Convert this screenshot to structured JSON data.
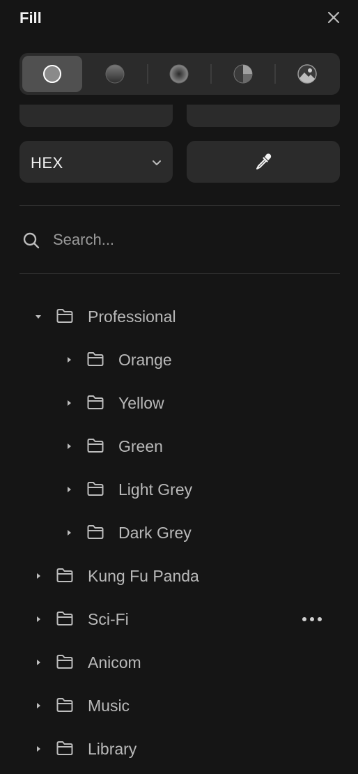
{
  "header": {
    "title": "Fill",
    "close_icon": "close-icon"
  },
  "fill_types": [
    {
      "name": "solid",
      "icon": "solid-fill-icon",
      "active": true
    },
    {
      "name": "linear-gradient",
      "icon": "linear-gradient-icon",
      "active": false
    },
    {
      "name": "radial-gradient",
      "icon": "radial-gradient-icon",
      "active": false
    },
    {
      "name": "angular-gradient",
      "icon": "angular-gradient-icon",
      "active": false
    },
    {
      "name": "image",
      "icon": "image-fill-icon",
      "active": false
    }
  ],
  "color_format": {
    "value": "HEX",
    "icon": "chevron-down-icon"
  },
  "eyedropper": {
    "icon": "eyedropper-icon"
  },
  "search": {
    "placeholder": "Search...",
    "value": "",
    "icon": "search-icon"
  },
  "tree": [
    {
      "label": "Professional",
      "expanded": true,
      "level": 0
    },
    {
      "label": "Orange",
      "expanded": false,
      "level": 1
    },
    {
      "label": "Yellow",
      "expanded": false,
      "level": 1
    },
    {
      "label": "Green",
      "expanded": false,
      "level": 1
    },
    {
      "label": "Light Grey",
      "expanded": false,
      "level": 1
    },
    {
      "label": "Dark Grey",
      "expanded": false,
      "level": 1
    },
    {
      "label": "Kung Fu Panda",
      "expanded": false,
      "level": 0
    },
    {
      "label": "Sci-Fi",
      "expanded": false,
      "level": 0,
      "hovered": true
    },
    {
      "label": "Anicom",
      "expanded": false,
      "level": 0
    },
    {
      "label": "Music",
      "expanded": false,
      "level": 0
    },
    {
      "label": "Library",
      "expanded": false,
      "level": 0
    }
  ],
  "colors": {
    "background": "#151515",
    "surface": "#2b2b2b",
    "active_surface": "#505050",
    "text": "#e8e8e8",
    "muted_text": "#b9b9b9"
  }
}
